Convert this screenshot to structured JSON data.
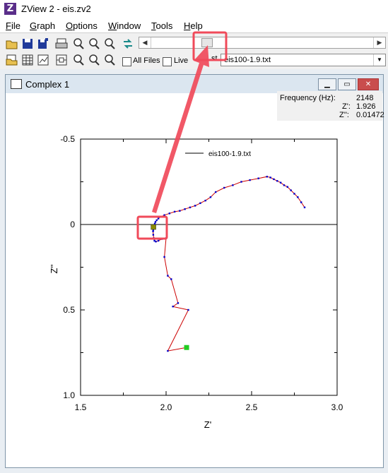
{
  "window": {
    "title": "ZView 2 - eis.zv2",
    "icon": "zview-app-icon"
  },
  "menu": [
    {
      "pre": "",
      "u": "F",
      "post": "ile"
    },
    {
      "pre": "",
      "u": "G",
      "post": "raph"
    },
    {
      "pre": "",
      "u": "O",
      "post": "ptions"
    },
    {
      "pre": "",
      "u": "W",
      "post": "indow"
    },
    {
      "pre": "",
      "u": "T",
      "post": "ools"
    },
    {
      "pre": "",
      "u": "H",
      "post": "elp"
    }
  ],
  "toolbar": {
    "all_files_label": "All Files",
    "live_label": "Live",
    "hidden_label_fragment": "st",
    "file_selected": "eis100-1.9.txt"
  },
  "graph_window": {
    "title": "Complex 1",
    "readout": {
      "frequency_label": "Frequency (Hz):",
      "frequency_value": "2148",
      "zreal_label": "Z':",
      "zreal_value": "1.926",
      "zimag_label": "Z'':",
      "zimag_value": "0.01472"
    }
  },
  "chart_data": {
    "type": "scatter",
    "xlabel": "Z'",
    "ylabel": "Z''",
    "xlim": [
      1.5,
      3.0
    ],
    "ylim": [
      -0.5,
      1.0
    ],
    "y_axis_inverted": true,
    "x_ticks": [
      "1.5",
      "2.0",
      "2.5",
      "3.0"
    ],
    "y_ticks": [
      "-0.5",
      "0",
      "0.5",
      "1.0"
    ],
    "legend": {
      "entry": "eis100-1.9.txt",
      "placement": "top-left"
    },
    "zero_line": true,
    "colors": {
      "points": "#0000cc",
      "line": "#cc0000",
      "start_marker": "#22cc22",
      "cursor_marker": "#777700",
      "highlight": "#f04a5a"
    },
    "series": [
      {
        "name": "eis100-1.9.txt",
        "x": [
          2.81,
          2.79,
          2.77,
          2.75,
          2.73,
          2.71,
          2.69,
          2.67,
          2.65,
          2.63,
          2.61,
          2.59,
          2.54,
          2.49,
          2.44,
          2.39,
          2.34,
          2.29,
          2.26,
          2.23,
          2.2,
          2.17,
          2.14,
          2.11,
          2.08,
          2.05,
          2.02,
          1.99,
          1.97,
          1.955,
          1.945,
          1.938,
          1.934,
          1.93,
          1.928,
          1.926,
          1.925,
          1.924,
          1.925,
          1.928,
          1.932,
          1.94,
          1.955,
          1.975,
          2.0,
          1.99,
          2.01,
          2.03,
          2.07,
          2.04,
          2.13,
          2.01,
          2.12
        ],
        "y": [
          -0.1,
          -0.13,
          -0.16,
          -0.18,
          -0.2,
          -0.22,
          -0.23,
          -0.245,
          -0.255,
          -0.265,
          -0.275,
          -0.28,
          -0.27,
          -0.26,
          -0.25,
          -0.23,
          -0.215,
          -0.19,
          -0.16,
          -0.14,
          -0.125,
          -0.11,
          -0.1,
          -0.09,
          -0.08,
          -0.075,
          -0.065,
          -0.055,
          -0.045,
          -0.035,
          -0.025,
          -0.015,
          -0.005,
          0.005,
          0.01,
          0.015,
          0.03,
          0.04,
          0.06,
          0.08,
          0.095,
          0.1,
          0.095,
          0.085,
          0.08,
          0.19,
          0.3,
          0.32,
          0.46,
          0.48,
          0.5,
          0.74,
          0.72
        ]
      }
    ],
    "start_point": {
      "x": 2.12,
      "y": 0.72
    },
    "cursor_point": {
      "x": 1.926,
      "y": 0.01472
    }
  }
}
